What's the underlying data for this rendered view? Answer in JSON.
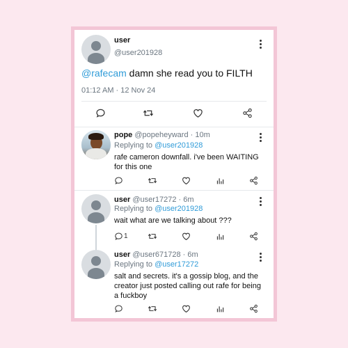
{
  "main_tweet": {
    "name": "user",
    "handle": "@user201928",
    "mention": "@rafecam",
    "text": " damn she read you to FILTH",
    "timestamp": "01:12 AM · 12 Nov 24"
  },
  "replies": [
    {
      "name": "pope",
      "handle": "@popeheyward",
      "time": "· 10m",
      "replying_prefix": "Replying to ",
      "replying_to": "@user201928",
      "text_lines": [
        "rafe cameron downfall. i've been WAITING",
        "for this one"
      ],
      "reply_count": ""
    },
    {
      "name": "user",
      "handle": "@user17272",
      "time": "· 6m",
      "replying_prefix": "Replying to ",
      "replying_to": "@user201928",
      "text_lines": [
        "wait what are we talking about ???"
      ],
      "reply_count": "1"
    },
    {
      "name": "user",
      "handle": "@user671728",
      "time": "· 6m",
      "replying_prefix": "Replying to ",
      "replying_to": "@user17272",
      "text_lines": [
        "salt and secrets. it's a gossip blog, and the",
        "creator just posted calling out rafe for being",
        "a fuckboy"
      ],
      "reply_count": ""
    }
  ],
  "icons": [
    "reply-icon",
    "retweet-icon",
    "like-icon",
    "stats-icon",
    "share-icon",
    "more-icon"
  ],
  "colors": {
    "link": "#2f9bd8",
    "frame": "#f3c6d6",
    "background": "#fce8ef"
  }
}
